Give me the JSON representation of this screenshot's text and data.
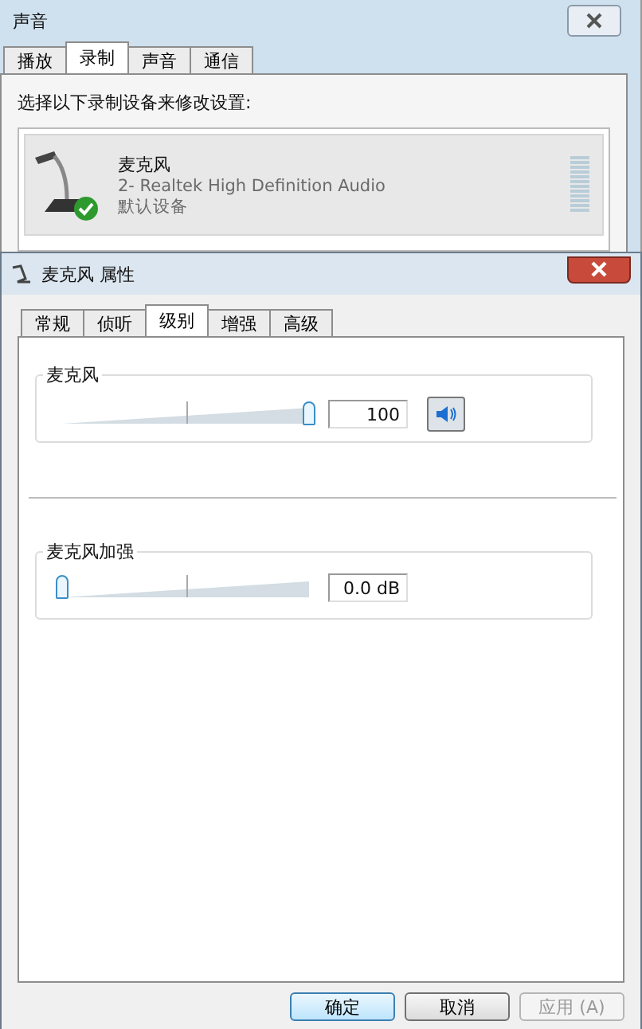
{
  "back_window": {
    "title": "声音",
    "tabs": [
      {
        "label": "播放",
        "selected": false
      },
      {
        "label": "录制",
        "selected": true
      },
      {
        "label": "声音",
        "selected": false
      },
      {
        "label": "通信",
        "selected": false
      }
    ],
    "instruction": "选择以下录制设备来修改设置:",
    "device": {
      "name": "麦克风",
      "description": "2- Realtek High Definition Audio",
      "status": "默认设备",
      "is_default": true
    }
  },
  "dialog": {
    "title": "麦克风 属性",
    "tabs": [
      {
        "label": "常规",
        "selected": false
      },
      {
        "label": "侦听",
        "selected": false
      },
      {
        "label": "级别",
        "selected": true
      },
      {
        "label": "增强",
        "selected": false
      },
      {
        "label": "高级",
        "selected": false
      }
    ],
    "groups": [
      {
        "label": "麦克风",
        "level": 1.0,
        "value": "100",
        "mute_button": true
      },
      {
        "label": "麦克风加强",
        "level": 0.0,
        "value": "0.0 dB",
        "mute_button": false
      }
    ],
    "buttons": [
      {
        "label": "确定",
        "default": true,
        "disabled": false
      },
      {
        "label": "取消",
        "default": false,
        "disabled": false
      },
      {
        "label": "应用 (A)",
        "default": false,
        "disabled": true
      }
    ]
  }
}
